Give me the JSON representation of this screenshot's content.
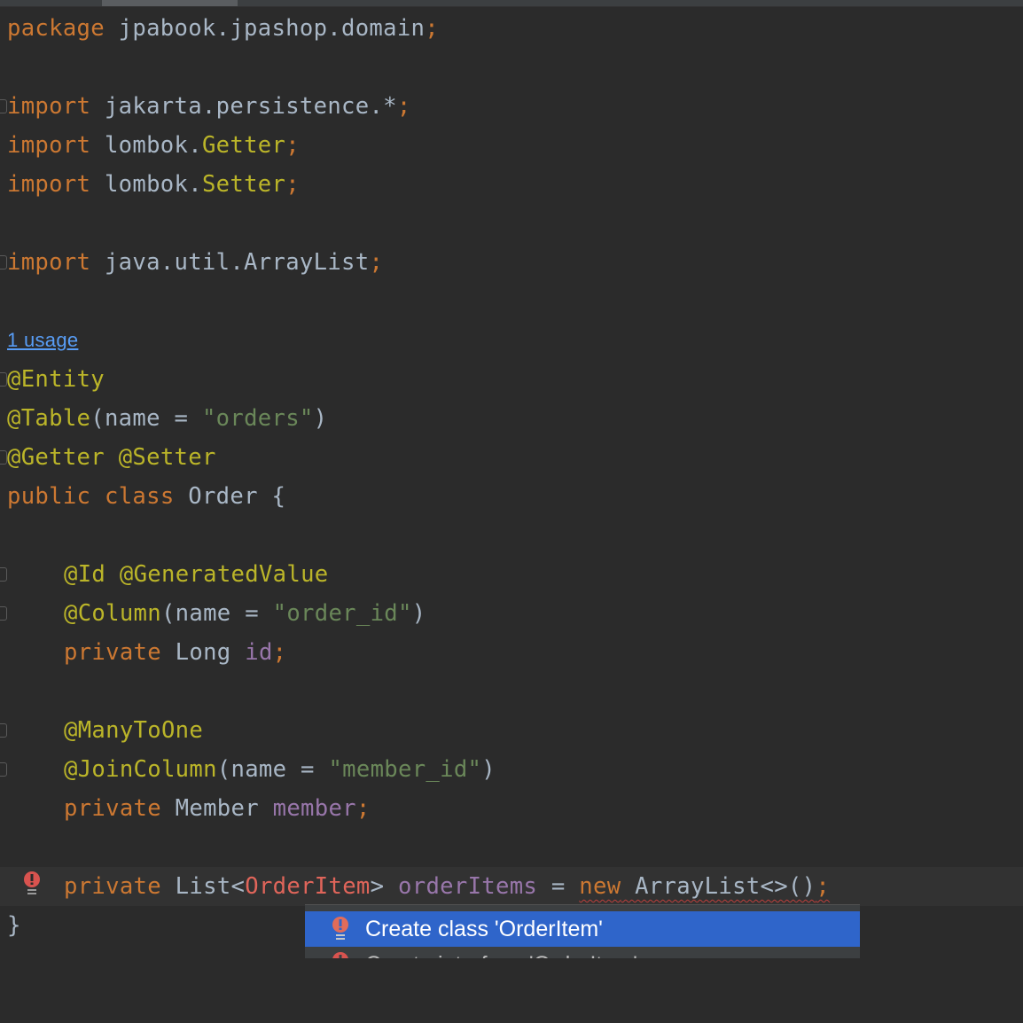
{
  "editor": {
    "package_kw": "package",
    "package_name": " jpabook.jpashop.domain",
    "semicolon": ";",
    "import_kw": "import",
    "import1": " jakarta.persistence.*",
    "import2_pkg": " lombok.",
    "import2_cls": "Getter",
    "import3_pkg": " lombok.",
    "import3_cls": "Setter",
    "import4": " java.util.ArrayList",
    "usage_hint": "1 usage",
    "ann_entity": "@Entity",
    "ann_table": "@Table",
    "table_args_open": "(name = ",
    "table_name": "\"orders\"",
    "close_paren": ")",
    "ann_getter": "@Getter",
    "ann_setter": "@Setter",
    "public_kw": "public",
    "class_kw": "class",
    "class_name": " Order {",
    "ann_id": "@Id",
    "ann_generated": "@GeneratedValue",
    "ann_column": "@Column",
    "column_args_open": "(name = ",
    "column_name": "\"order_id\"",
    "private_kw": "private",
    "long_type": " Long ",
    "id_field": "id",
    "ann_manytoone": "@ManyToOne",
    "ann_joincolumn": "@JoinColumn",
    "join_args_open": "(name = ",
    "join_name": "\"member_id\"",
    "member_type": " Member ",
    "member_field": "member",
    "list_type": " List<",
    "orderitem_type": "OrderItem",
    "list_close": "> ",
    "orderitems_field": "orderItems",
    "assign": " = ",
    "new_kw": "new",
    "arraylist_ctor": " ArrayList<>()",
    "closing_brace": "}"
  },
  "popup": {
    "items": [
      {
        "label": "Create class 'OrderItem'"
      },
      {
        "label": "Create interface 'OrderItem'"
      }
    ]
  },
  "icons": {
    "fold": "fold-marker-icon",
    "error_bulb": "error-bulb-icon"
  },
  "colors": {
    "background": "#2b2b2b",
    "keyword": "#cc7832",
    "annotation": "#bbb529",
    "string": "#6a8759",
    "field": "#9876aa",
    "default_text": "#a9b7c6",
    "error": "#e0655a",
    "selection": "#2f65ca",
    "link": "#589df6"
  }
}
